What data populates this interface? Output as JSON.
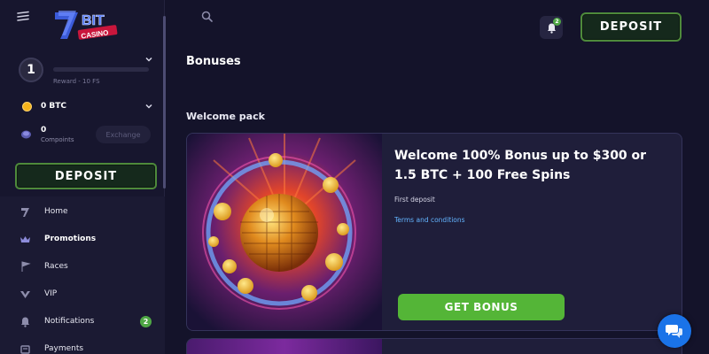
{
  "brand": {
    "logo_text_top": "BIT",
    "logo_text_bottom": "CASINO"
  },
  "sidebar": {
    "level": "1",
    "level_caption": "Reward - 10 FS",
    "level_progress": 0,
    "balance": "0 BTC",
    "compoints_value": "0",
    "compoints_label": "Compoints",
    "exchange_label": "Exchange",
    "deposit_label": "DEPOSIT",
    "nav": [
      {
        "label": "Home",
        "icon": "home-logo-icon",
        "active": false
      },
      {
        "label": "Promotions",
        "icon": "promotions-icon",
        "active": true
      },
      {
        "label": "Races",
        "icon": "races-icon",
        "active": false
      },
      {
        "label": "VIP",
        "icon": "vip-icon",
        "active": false
      },
      {
        "label": "Notifications",
        "icon": "bell-icon",
        "active": false,
        "badge": "2"
      },
      {
        "label": "Payments",
        "icon": "payments-icon",
        "active": false
      }
    ]
  },
  "topbar": {
    "notifications_count": "2",
    "deposit_label": "DEPOSIT"
  },
  "main": {
    "page_title": "Bonuses",
    "section_title": "Welcome pack",
    "bonus": {
      "title": "Welcome 100% Bonus up to $300 or 1.5 BTC + 100 Free Spins",
      "subtitle": "First deposit",
      "terms_label": "Terms and conditions",
      "cta_label": "GET BONUS"
    }
  },
  "colors": {
    "background": "#14132a",
    "sidebar": "#17162e",
    "card": "#1f1e3a",
    "accent_green": "#54b537",
    "deposit_border": "#4e8a3b",
    "link_blue": "#63b4ff",
    "chat_blue": "#1a73e8",
    "coin_gold": "#f5b31b"
  }
}
